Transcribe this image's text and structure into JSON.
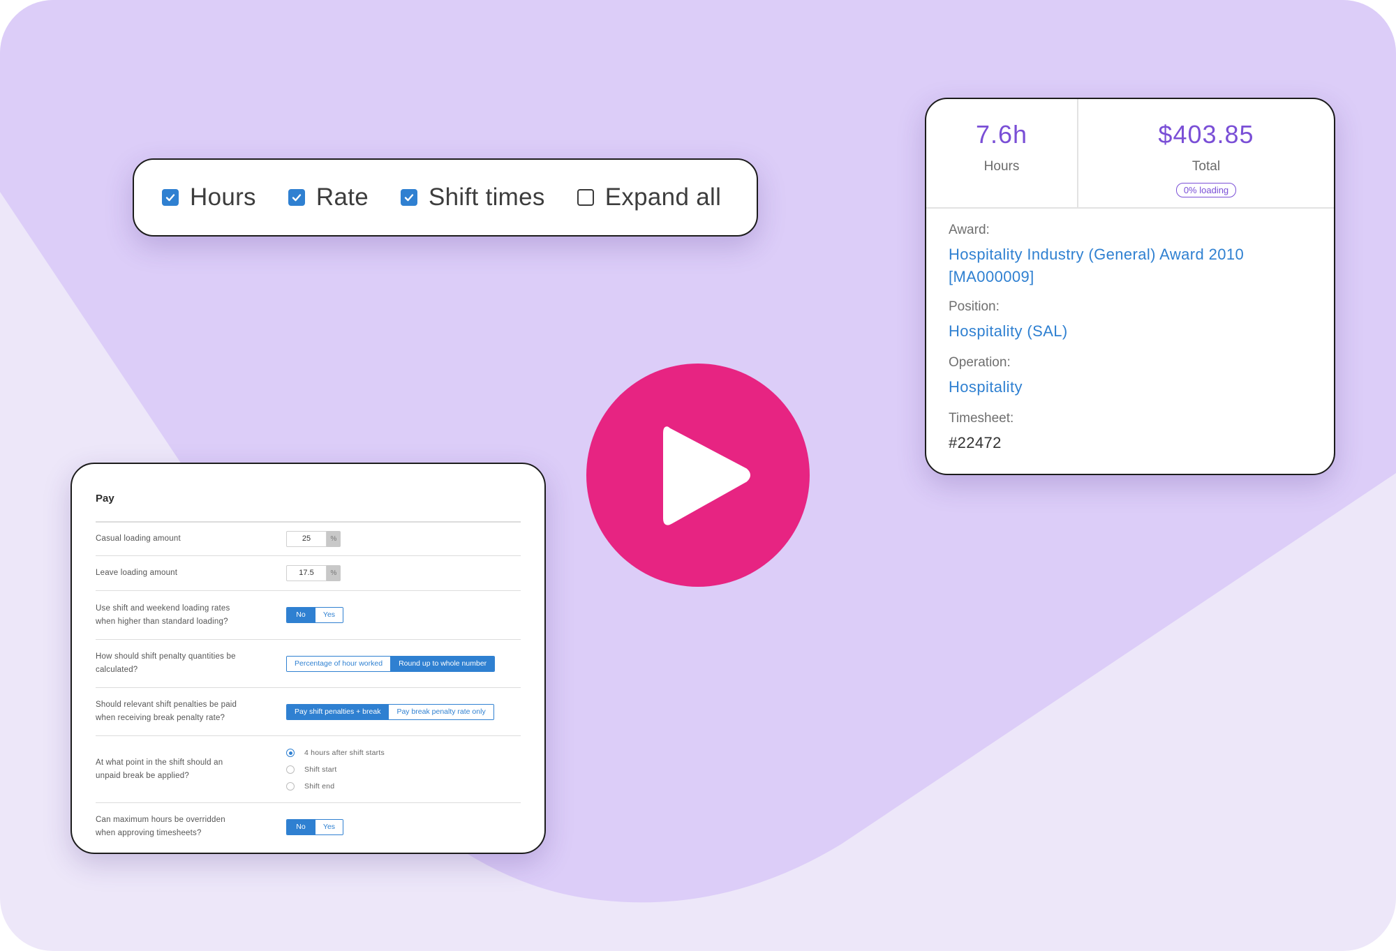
{
  "filters": {
    "items": [
      {
        "label": "Hours",
        "checked": true
      },
      {
        "label": "Rate",
        "checked": true
      },
      {
        "label": "Shift times",
        "checked": true
      },
      {
        "label": "Expand all",
        "checked": false
      }
    ]
  },
  "summary": {
    "hours_value": "7.6h",
    "hours_label": "Hours",
    "total_value": "$403.85",
    "total_label": "Total",
    "loading_badge": "0% loading",
    "award_label": "Award:",
    "award_value_line1": "Hospitality Industry (General) Award 2010",
    "award_value_line2": "[MA000009]",
    "position_label": "Position:",
    "position_value": "Hospitality (SAL)",
    "operation_label": "Operation:",
    "operation_value": "Hospitality",
    "timesheet_label": "Timesheet:",
    "timesheet_value": "#22472"
  },
  "play_button": {
    "icon": "play-icon"
  },
  "pay": {
    "title": "Pay",
    "casual_loading": {
      "label": "Casual loading amount",
      "value": "25",
      "suffix": "%"
    },
    "leave_loading": {
      "label": "Leave loading amount",
      "value": "17.5",
      "suffix": "%"
    },
    "shift_weekend_rates": {
      "label_line1": "Use shift and weekend loading rates",
      "label_line2": "when higher than standard loading?",
      "options": [
        "No",
        "Yes"
      ],
      "selected": "No"
    },
    "penalty_quantities": {
      "label_line1": "How should shift penalty quantities be",
      "label_line2": "calculated?",
      "options": [
        "Percentage of hour worked",
        "Round up to whole number"
      ],
      "selected": "Round up to whole number"
    },
    "break_penalty": {
      "label_line1": "Should relevant shift penalties be paid",
      "label_line2": "when receiving break penalty rate?",
      "options": [
        "Pay shift penalties + break",
        "Pay break penalty rate only"
      ],
      "selected": "Pay shift penalties + break"
    },
    "unpaid_break": {
      "label_line1": "At what point in the shift should an",
      "label_line2": "unpaid break be applied?",
      "options": [
        "4 hours after shift starts",
        "Shift start",
        "Shift end"
      ],
      "selected": "4 hours after shift starts"
    },
    "max_hours_override": {
      "label_line1": "Can maximum hours be overridden",
      "label_line2": "when approving timesheets?",
      "options": [
        "No",
        "Yes"
      ],
      "selected": "No"
    }
  },
  "colors": {
    "background_light": "#ede7f9",
    "background_purple": "#dccdf8",
    "accent_blue": "#2f80d1",
    "accent_purple": "#7a4fd6",
    "play_pink": "#e72482"
  }
}
